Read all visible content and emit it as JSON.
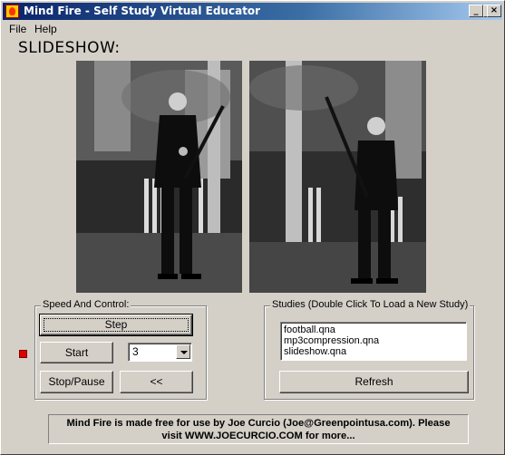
{
  "window": {
    "title": "Mind Fire - Self Study Virtual Educator",
    "minimize": "_",
    "maximize": "□",
    "close": "×"
  },
  "menu": {
    "file": "File",
    "help": "Help"
  },
  "slideshow": {
    "label": "SLIDESHOW:"
  },
  "speed_control": {
    "label": "Speed  And Control:",
    "step": "Step",
    "start": "Start",
    "combo_value": "3",
    "stop_pause": "Stop/Pause",
    "back": "<<"
  },
  "studies": {
    "label": "Studies (Double Click To Load a New Study)",
    "items": [
      "football.qna",
      "mp3compression.qna",
      "slideshow.qna"
    ],
    "refresh": "Refresh"
  },
  "notice": {
    "line1": "Mind Fire is made free for use by Joe Curcio (Joe@Greenpointusa.com).  Please",
    "line2": "visit WWW.JOECURCIO.COM for more..."
  },
  "colors": {
    "title_start": "#0a246a",
    "title_end": "#a6caf0",
    "face": "#d4d0c8",
    "indicator": "#e00000"
  }
}
